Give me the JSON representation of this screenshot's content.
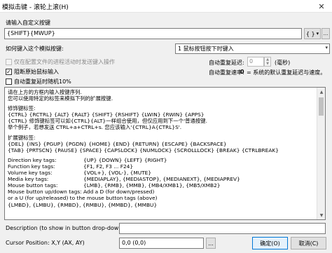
{
  "window": {
    "title": "模拟击键 - 滚轮上滚(H)",
    "close_glyph": "✕"
  },
  "keys": {
    "label": "请输入自定义按键",
    "value": "{SHIFT}{MWUP}",
    "brace_button": "{ }",
    "dropdown_glyph": "▾",
    "extra_button": "..."
  },
  "input_mode": {
    "label": "如何键入这个模拟按键:",
    "selected": "1 鼠标按钮按下时键入",
    "arrow": "▾"
  },
  "options": {
    "send_when_configured": {
      "label": "仅在配置文件的进程活动时发送键入操作",
      "checked": false,
      "enabled": false
    },
    "block_original": {
      "label": "阻断原始鼠标输入",
      "checked": true,
      "enabled": true
    },
    "auto_repeat_random": {
      "label": "自动重复延时随机10%",
      "checked": false,
      "enabled": true
    }
  },
  "repeat_delay": {
    "label": "自动重复延迟:",
    "value": "0",
    "unit": "(毫秒)",
    "up": "▲",
    "down": "▼"
  },
  "repeat_rate": {
    "label": "自动重复速率:",
    "note_value": "0",
    "note": "= 系统的默认重复延迟与速度。"
  },
  "help": {
    "lines_top": [
      "请在上方的方框内输入按键序列.",
      "您可以使用特定的标签来模拟下列的扩展按键."
    ],
    "modifier_title": "修饰键标签:",
    "modifier_tags": " {CTRL} {RCTRL} {ALT} {RALT} {SHIFT} {RSHIFT} {LWIN} {RWIN} {APPS}",
    "modifier_note1": " {CTRL}  修饰键标签可以如{CTRL}{ALT}一样组合使用，但仅应用到下一个'普通按键.",
    "modifier_note2": "        举个例子，若想发送 CTRL+a+CTRL+s. 您应该输入'{CTRL}A{CTRL}S'.",
    "extended_title": "扩展键标签:",
    "extended_tags1": " {DEL} {INS} {PGUP} {PGDN} {HOME} {END} {RETURN} {ESCAPE} {BACKSPACE}",
    "extended_tags2": " {TAB} {PRTSCN} {PAUSE} {SPACE} {CAPSLOCK} {NUMLOCK} {SCROLLLOCK} {BREAK} {CTRLBREAK}",
    "tag_rows": [
      {
        "name": "Direction key tags:",
        "value": "{UP} {DOWN} {LEFT} {RIGHT}"
      },
      {
        "name": "Function key tags:",
        "value": "{F1, F2, F3 ... F24}"
      },
      {
        "name": "Volume key tags:",
        "value": "{VOL+}, {VOL-}, {MUTE}"
      },
      {
        "name": "Media key tags:",
        "value": "{MEDIAPLAY}, {MEDIASTOP}, {MEDIANEXT}, {MEDIAPREV}"
      },
      {
        "name": "Mouse button tags:",
        "value": "{LMB}, {RMB}, {MMB}, {MB4/XMB1}, {MB5/XMB2}"
      },
      {
        "name": "Mouse button up/down tags:",
        "value": "        Add a D (for down/pressed)"
      }
    ],
    "trailing_line": "        or a U (for up/released) to the mouse button tags (above)",
    "cut_line": "        {LMBD}, {LMBU}, {RMBD}, {RMBU}, {MMBD}, {MMBU}",
    "scroll_up": "▲",
    "scroll_down": "▼"
  },
  "description": {
    "label": "Description (to show in button drop-down)",
    "value": ""
  },
  "cursor": {
    "label": "Cursor Position: X,Y (AX, AY)",
    "value": "0,0 (0,0)",
    "pick_button": "..."
  },
  "buttons": {
    "ok": "确定(O)",
    "cancel": "取消(C)"
  }
}
